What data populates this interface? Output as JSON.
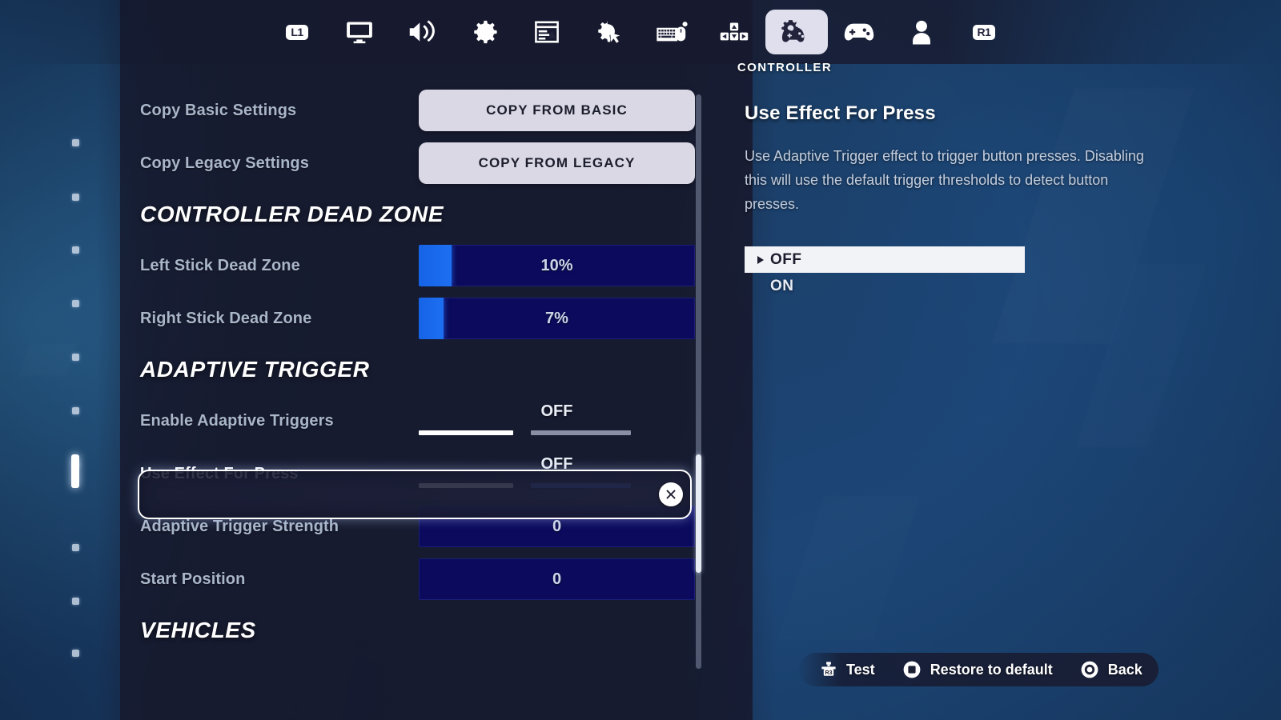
{
  "nav": {
    "left_bumper": "L1",
    "right_bumper": "R1",
    "selected_label": "CONTROLLER",
    "items": [
      {
        "icon": "l1-bumper-icon",
        "name": "nav-bumper-left",
        "selected": false
      },
      {
        "icon": "monitor-icon",
        "name": "nav-tab-video",
        "selected": false
      },
      {
        "icon": "speaker-icon",
        "name": "nav-tab-audio",
        "selected": false
      },
      {
        "icon": "gear-icon",
        "name": "nav-tab-game",
        "selected": false
      },
      {
        "icon": "brightness-window-icon",
        "name": "nav-tab-brightness",
        "selected": false
      },
      {
        "icon": "gear-cursor-icon",
        "name": "nav-tab-accessibility",
        "selected": false
      },
      {
        "icon": "keyboard-mouse-icon",
        "name": "nav-tab-keyboard-mouse",
        "selected": false
      },
      {
        "icon": "dpad-keybinds-icon",
        "name": "nav-tab-keybinds",
        "selected": false
      },
      {
        "icon": "controller-gear-icon",
        "name": "nav-tab-controller",
        "selected": true
      },
      {
        "icon": "controller-icon",
        "name": "nav-tab-controller-config",
        "selected": false
      },
      {
        "icon": "person-icon",
        "name": "nav-tab-account",
        "selected": false
      },
      {
        "icon": "r1-bumper-icon",
        "name": "nav-bumper-right",
        "selected": false
      }
    ]
  },
  "page_rail": {
    "total_dots": 11,
    "active_index": 7
  },
  "settings": [
    {
      "type": "button",
      "label": "Copy Basic Settings",
      "value": "COPY FROM BASIC"
    },
    {
      "type": "button",
      "label": "Copy Legacy Settings",
      "value": "COPY FROM LEGACY"
    },
    {
      "type": "header",
      "label": "CONTROLLER DEAD ZONE"
    },
    {
      "type": "slider",
      "label": "Left Stick Dead Zone",
      "value": "10%",
      "fill_percent": 10
    },
    {
      "type": "slider",
      "label": "Right Stick Dead Zone",
      "value": "7%",
      "fill_percent": 7
    },
    {
      "type": "header",
      "label": "ADAPTIVE TRIGGER"
    },
    {
      "type": "toggle",
      "label": "Enable Adaptive Triggers",
      "value": "OFF"
    },
    {
      "type": "toggle",
      "label": "Use Effect For Press",
      "value": "OFF",
      "highlighted": true
    },
    {
      "type": "number",
      "label": "Adaptive Trigger Strength",
      "value": "0"
    },
    {
      "type": "number",
      "label": "Start Position",
      "value": "0"
    },
    {
      "type": "header",
      "label": "VEHICLES"
    }
  ],
  "detail": {
    "title": "Use Effect For Press",
    "description": "Use Adaptive Trigger effect to trigger button presses. Disabling this will use the default trigger thresholds to detect button presses.",
    "options": [
      {
        "label": "OFF",
        "selected": true
      },
      {
        "label": "ON",
        "selected": false
      }
    ]
  },
  "action_bar": [
    {
      "icon": "r3-stick-press-icon",
      "label": "Test"
    },
    {
      "icon": "square-button-icon",
      "label": "Restore to default"
    },
    {
      "icon": "circle-button-icon",
      "label": "Back"
    }
  ],
  "colors": {
    "slider_fill": "#1663e6",
    "slider_track": "#0b0a5c",
    "accent_white": "#ffffff",
    "label_grey": "#a9b6c9"
  }
}
